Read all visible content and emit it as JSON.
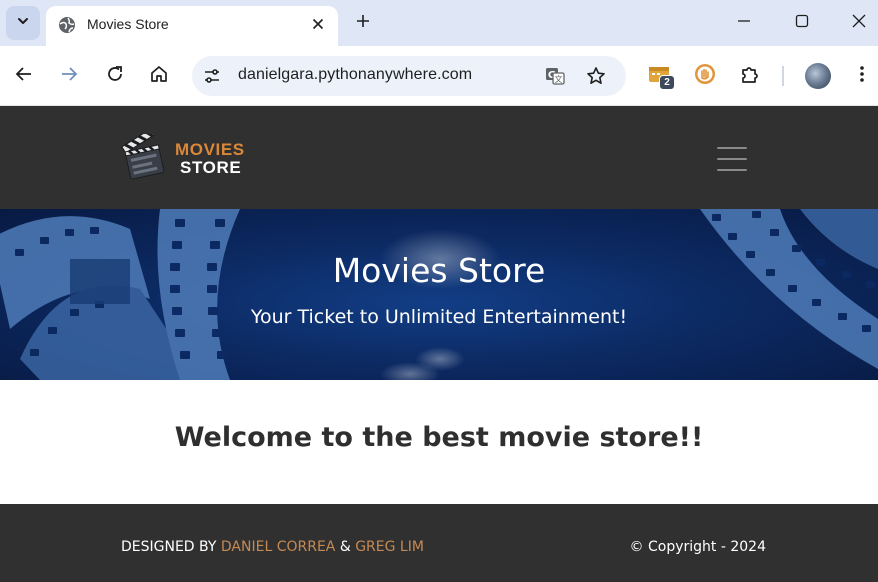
{
  "browser": {
    "tab_title": "Movies Store",
    "url": "danielgara.pythonanywhere.com",
    "extension_badge": "2",
    "icons": [
      "tab-search-icon",
      "globe-icon",
      "close-icon",
      "plus-icon",
      "minimize-icon",
      "maximize-icon",
      "window-close-icon",
      "back-arrow-icon",
      "forward-arrow-icon",
      "reload-icon",
      "home-icon",
      "site-settings-icon",
      "translate-icon",
      "star-icon",
      "extension-icon",
      "hand-icon",
      "puzzle-icon",
      "menu-dots-icon"
    ]
  },
  "navbar": {
    "logo_line1": "MOVIES",
    "logo_line2": "STORE"
  },
  "hero": {
    "title": "Movies Store",
    "subtitle": "Your Ticket to Unlimited Entertainment!"
  },
  "main": {
    "welcome": "Welcome to the best movie store!!"
  },
  "footer": {
    "designed_by": "DESIGNED BY ",
    "author1": "DANIEL CORREA",
    "ampersand": " & ",
    "author2": "GREG LIM",
    "copyright": "© Copyright - 2024"
  },
  "colors": {
    "accent": "#d9883a",
    "footer_link": "#c58a54",
    "navbar_bg": "#303030",
    "hero_bg": "#0c2a63"
  }
}
